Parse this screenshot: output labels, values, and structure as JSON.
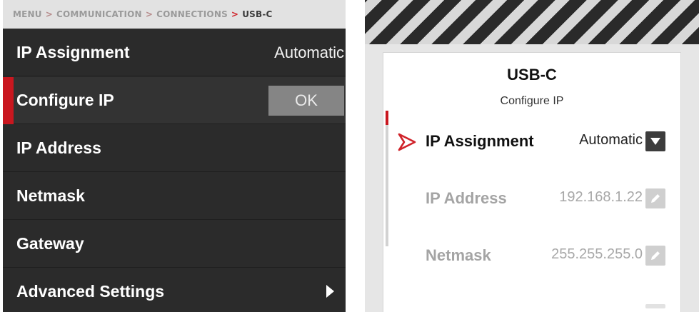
{
  "left_panel": {
    "breadcrumb": {
      "items": [
        "MENU",
        "COMMUNICATION",
        "CONNECTIONS"
      ],
      "current": "USB-C",
      "separator": ">"
    },
    "rows": [
      {
        "label": "IP Assignment",
        "value": "Automatic"
      },
      {
        "label": "Configure IP",
        "button": "OK",
        "selected": true
      },
      {
        "label": "IP Address"
      },
      {
        "label": "Netmask"
      },
      {
        "label": "Gateway"
      },
      {
        "label": "Advanced Settings",
        "icon": "chevron-right-icon"
      }
    ]
  },
  "right_panel": {
    "title": "USB-C",
    "subtitle": "Configure IP",
    "rows": [
      {
        "label": "IP Assignment",
        "value": "Automatic",
        "control": "dropdown-icon",
        "active": true
      },
      {
        "label": "IP Address",
        "value": "192.168.1.22",
        "control": "edit-pencil-icon"
      },
      {
        "label": "Netmask",
        "value": "255.255.255.0",
        "control": "edit-pencil-icon"
      }
    ]
  },
  "colors": {
    "accent_red": "#c9171f",
    "dark_bg": "#2b2b2b",
    "button_gray": "#858585"
  }
}
